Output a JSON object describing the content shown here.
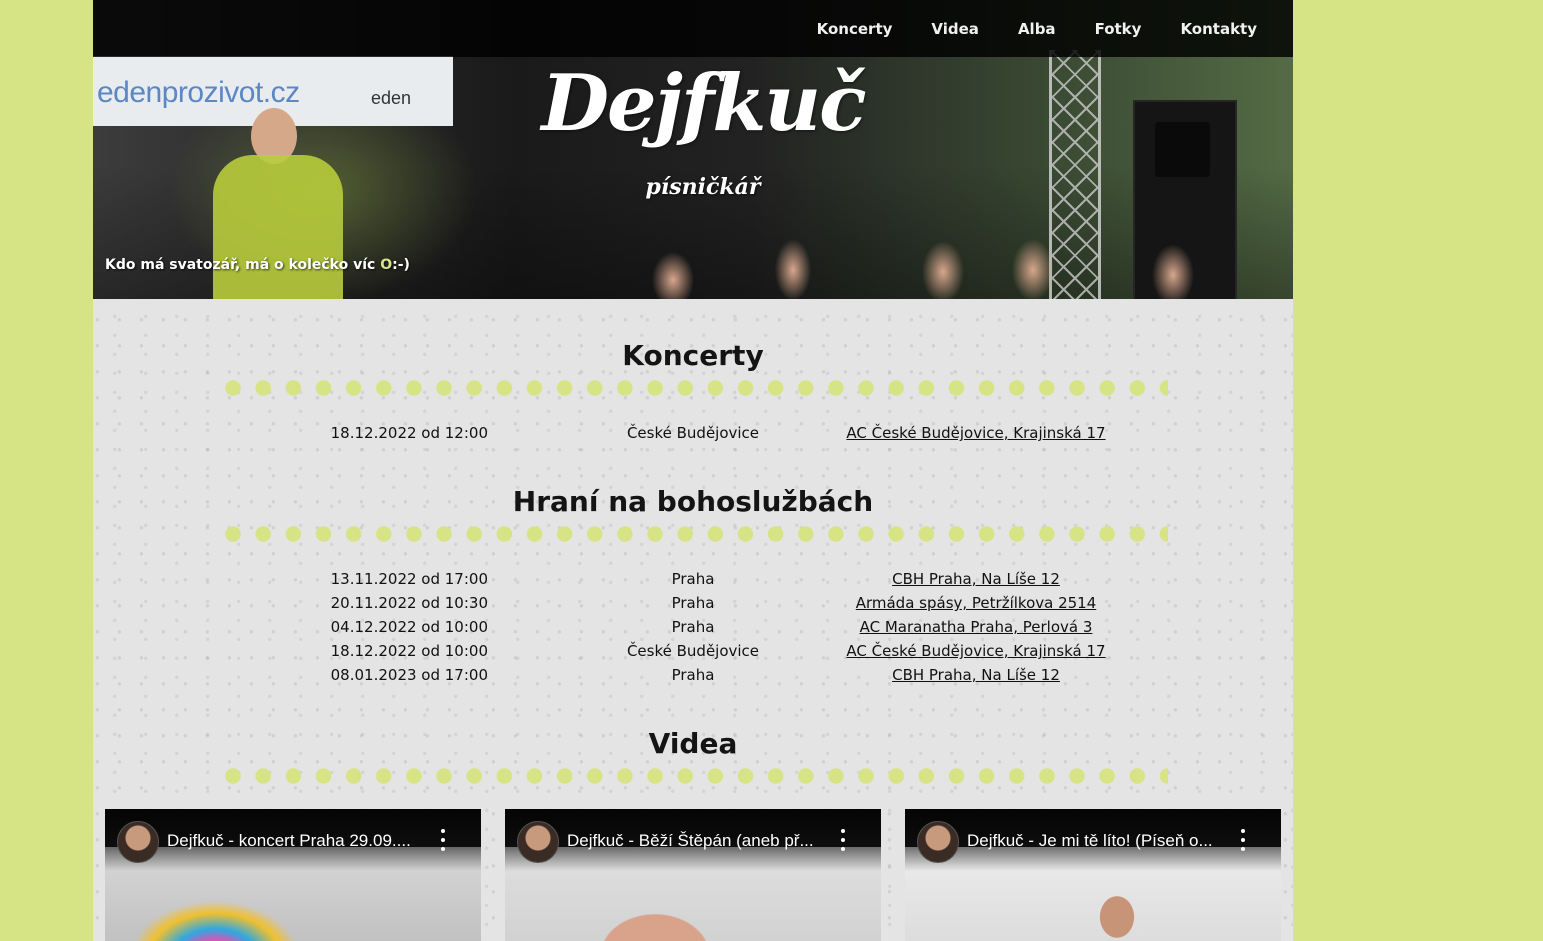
{
  "nav": {
    "items": [
      "Koncerty",
      "Videa",
      "Alba",
      "Fotky",
      "Kontakty"
    ]
  },
  "hero": {
    "banner_text": "edenprozivot.cz",
    "banner_logo": "eden",
    "logo": "Dejfkuč",
    "tagline": "písničkář",
    "motto_before": "Kdo má svatozář, má o kolečko víc ",
    "motto_highlight": "O",
    "motto_after": ":-)"
  },
  "concerts": {
    "title": "Koncerty",
    "rows": [
      {
        "date": "18.12.2022 od 12:00",
        "city": "České Budějovice",
        "venue": "AC České Budějovice, Krajinská 17"
      }
    ]
  },
  "services": {
    "title": "Hraní na bohoslužbách",
    "rows": [
      {
        "date": "13.11.2022 od 17:00",
        "city": "Praha",
        "venue": "CBH Praha, Na Líše 12"
      },
      {
        "date": "20.11.2022 od 10:30",
        "city": "Praha",
        "venue": "Armáda spásy, Petržílkova 2514"
      },
      {
        "date": "04.12.2022 od 10:00",
        "city": "Praha",
        "venue": "AC Maranatha Praha, Perlová 3"
      },
      {
        "date": "18.12.2022 od 10:00",
        "city": "České Budějovice",
        "venue": "AC České Budějovice, Krajinská 17"
      },
      {
        "date": "08.01.2023 od 17:00",
        "city": "Praha",
        "venue": "CBH Praha, Na Líše 12"
      }
    ]
  },
  "videos": {
    "title": "Videa",
    "items": [
      {
        "title": "Dejfkuč - koncert Praha 29.09...."
      },
      {
        "title": "Dejfkuč - Běží Štěpán (aneb př..."
      },
      {
        "title": "Dejfkuč - Je mi tě líto! (Píseň o..."
      }
    ]
  },
  "colors": {
    "accent": "#d6e486",
    "nav_bg": "#000000",
    "text": "#111111"
  }
}
